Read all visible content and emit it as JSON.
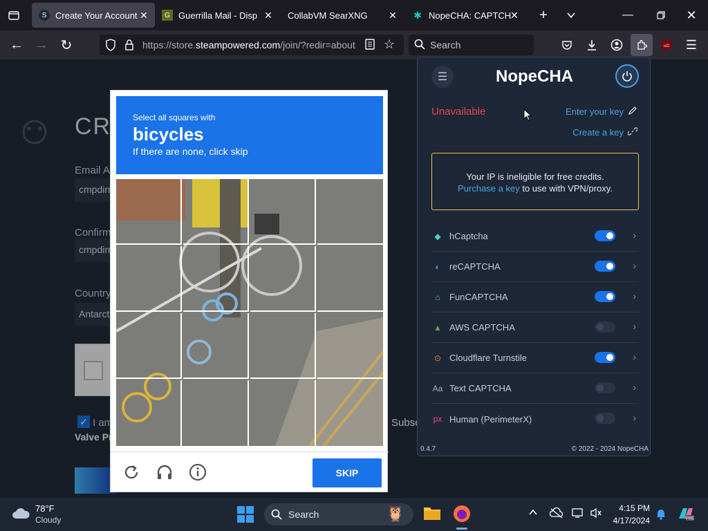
{
  "browser": {
    "tabs": [
      {
        "label": "Create Your Account",
        "active": true
      },
      {
        "label": "Guerrilla Mail - Disp",
        "active": false
      },
      {
        "label": "CollabVM SearXNG",
        "active": false
      },
      {
        "label": "NopeCHA: CAPTCHA S",
        "active": false
      }
    ],
    "url_prefix": "https://store.",
    "url_domain": "steampowered.com",
    "url_suffix": "/join/?redir=about",
    "search_placeholder": "Search"
  },
  "page": {
    "heading": "CRE",
    "email_label": "Email Ad",
    "email_value": "cmpdirr",
    "confirm_label": "Confirm",
    "confirm_value": "cmpdirr",
    "country_label": "Country",
    "country_value": "Antarct",
    "agree_text": "I am",
    "valve_text": "Valve Pr",
    "subscriber_text": "Subsc"
  },
  "captcha": {
    "instruction_small": "Select all squares with",
    "target": "bicycles",
    "instruction_hint": "If there are none, click skip",
    "skip_label": "SKIP"
  },
  "nopecha": {
    "brand": "NopeCHA",
    "status": "Unavailable",
    "enter_key_label": "Enter your key",
    "create_key_label": "Create a key",
    "notice_line1": "Your IP is ineligible for free credits.",
    "notice_link": "Purchase a key",
    "notice_line2": " to use with VPN/proxy.",
    "version": "0.4.7",
    "copyright": "© 2022 - 2024 NopeCHA",
    "services": [
      {
        "label": "hCaptcha",
        "icon": "hcaptcha-icon",
        "enabled": true
      },
      {
        "label": "reCAPTCHA",
        "icon": "recaptcha-icon",
        "enabled": true
      },
      {
        "label": "FunCAPTCHA",
        "icon": "funcaptcha-icon",
        "enabled": true
      },
      {
        "label": "AWS CAPTCHA",
        "icon": "aws-icon",
        "enabled": false
      },
      {
        "label": "Cloudflare Turnstile",
        "icon": "cloudflare-icon",
        "enabled": true
      },
      {
        "label": "Text CAPTCHA",
        "icon": "text-icon",
        "enabled": false
      },
      {
        "label": "Human (PerimeterX)",
        "icon": "perimeterx-icon",
        "enabled": false
      }
    ],
    "accent": "#1a73e8",
    "warning_border": "#e6c84a",
    "status_color": "#e5484d"
  },
  "taskbar": {
    "temperature": "78°F",
    "weather": "Cloudy",
    "search_label": "Search",
    "time": "4:15 PM",
    "date": "4/17/2024"
  }
}
